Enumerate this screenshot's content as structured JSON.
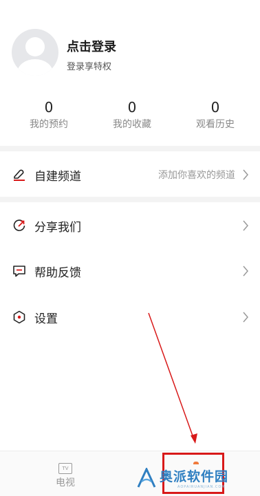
{
  "profile": {
    "title": "点击登录",
    "subtitle": "登录享特权",
    "avatar_icon": "user-avatar-icon"
  },
  "stats": [
    {
      "value": "0",
      "label": "我的预约"
    },
    {
      "value": "0",
      "label": "我的收藏"
    },
    {
      "value": "0",
      "label": "观看历史"
    }
  ],
  "menu": {
    "custom_channel": {
      "label": "自建频道",
      "hint": "添加你喜欢的频道",
      "icon": "edit-channel-icon",
      "icon_color": "#d81919"
    },
    "share": {
      "label": "分享我们",
      "icon": "share-icon"
    },
    "feedback": {
      "label": "帮助反馈",
      "icon": "feedback-icon"
    },
    "settings": {
      "label": "设置",
      "icon": "settings-icon"
    }
  },
  "tabbar": {
    "tv": {
      "label": "电视",
      "icon_text": "TV"
    }
  },
  "watermark": {
    "text": "奥派软件园",
    "url": "AOPAIRUANJIAN.COM"
  },
  "colors": {
    "accent_red": "#d81919",
    "watermark_blue": "#2f7fc1",
    "separator": "#f3f3f3"
  }
}
